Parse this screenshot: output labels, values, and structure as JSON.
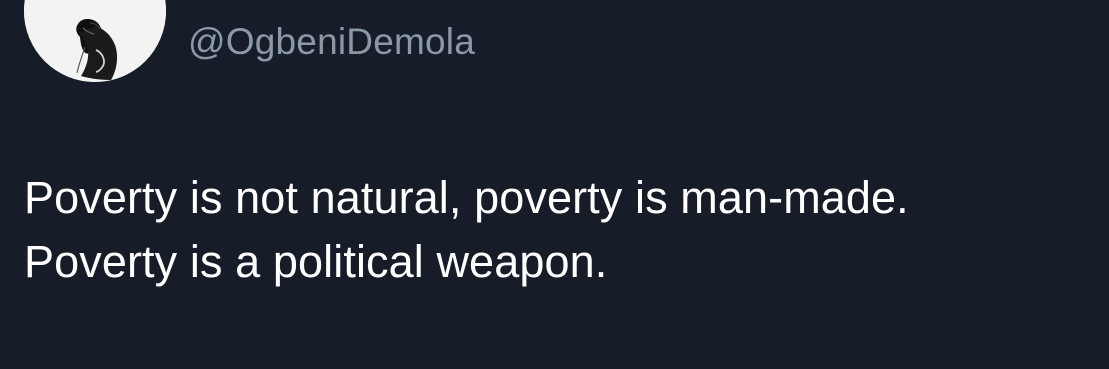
{
  "user": {
    "handle": "@OgbeniDemola",
    "avatar_icon": "profile-photo"
  },
  "tweet": {
    "lines": [
      "Poverty is not natural, poverty is man-made.",
      "Poverty is a political weapon."
    ]
  },
  "colors": {
    "background": "#171d28",
    "handle": "#8b98a5",
    "text": "#ffffff"
  }
}
